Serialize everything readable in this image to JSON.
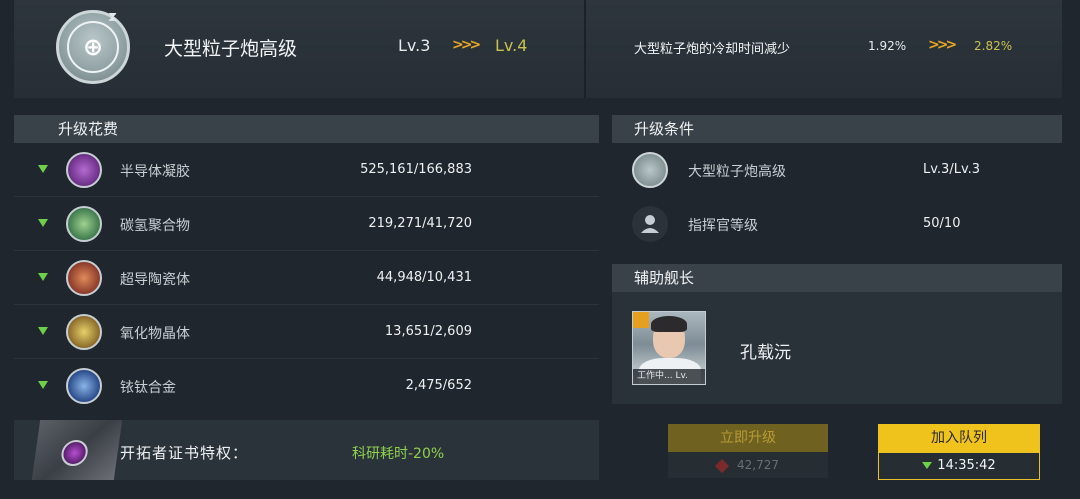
{
  "tech": {
    "name": "大型粒子炮高级",
    "level_from": "Lv.3",
    "level_to": "Lv.4",
    "arrows": ">>>",
    "effect_text": "大型粒子炮的冷却时间减少",
    "effect_from": "1.92%",
    "effect_to": "2.82%",
    "icon": "particle-cannon-icon"
  },
  "cost": {
    "title": "升级花费",
    "items": [
      {
        "name": "半导体凝胶",
        "value": "525,161/166,883",
        "icon": "semiconductor-gel-icon",
        "color": "#8e4aa6"
      },
      {
        "name": "碳氢聚合物",
        "value": "219,271/41,720",
        "icon": "hydrocarbon-polymer-icon",
        "color": "#4a8e5a"
      },
      {
        "name": "超导陶瓷体",
        "value": "44,948/10,431",
        "icon": "superconductor-ceramic-icon",
        "color": "#c65a3a"
      },
      {
        "name": "氧化物晶体",
        "value": "13,651/2,609",
        "icon": "oxide-crystal-icon",
        "color": "#b9a23a"
      },
      {
        "name": "铱钛合金",
        "value": "2,475/652",
        "icon": "iridium-titanium-alloy-icon",
        "color": "#4a78b9"
      }
    ]
  },
  "conditions": {
    "title": "升级条件",
    "items": [
      {
        "name": "大型粒子炮高级",
        "value": "Lv.3/Lv.3",
        "icon": "particle-cannon-icon"
      },
      {
        "name": "指挥官等级",
        "value": "50/10",
        "icon": "commander-icon"
      }
    ]
  },
  "assistant": {
    "title": "辅助舰长",
    "captain_name": "孔载沅",
    "status": "工作中...",
    "level": "Lv."
  },
  "perk": {
    "label": "开拓者证书特权：",
    "value": "科研耗时-20%"
  },
  "buttons": {
    "instant_label": "立即升级",
    "instant_cost": "42,727",
    "queue_label": "加入队列",
    "queue_time": "14:35:42"
  },
  "colors": {
    "accent_yellow": "#f0c21c",
    "green": "#6fcf4a",
    "level_to": "#c9c24d"
  }
}
